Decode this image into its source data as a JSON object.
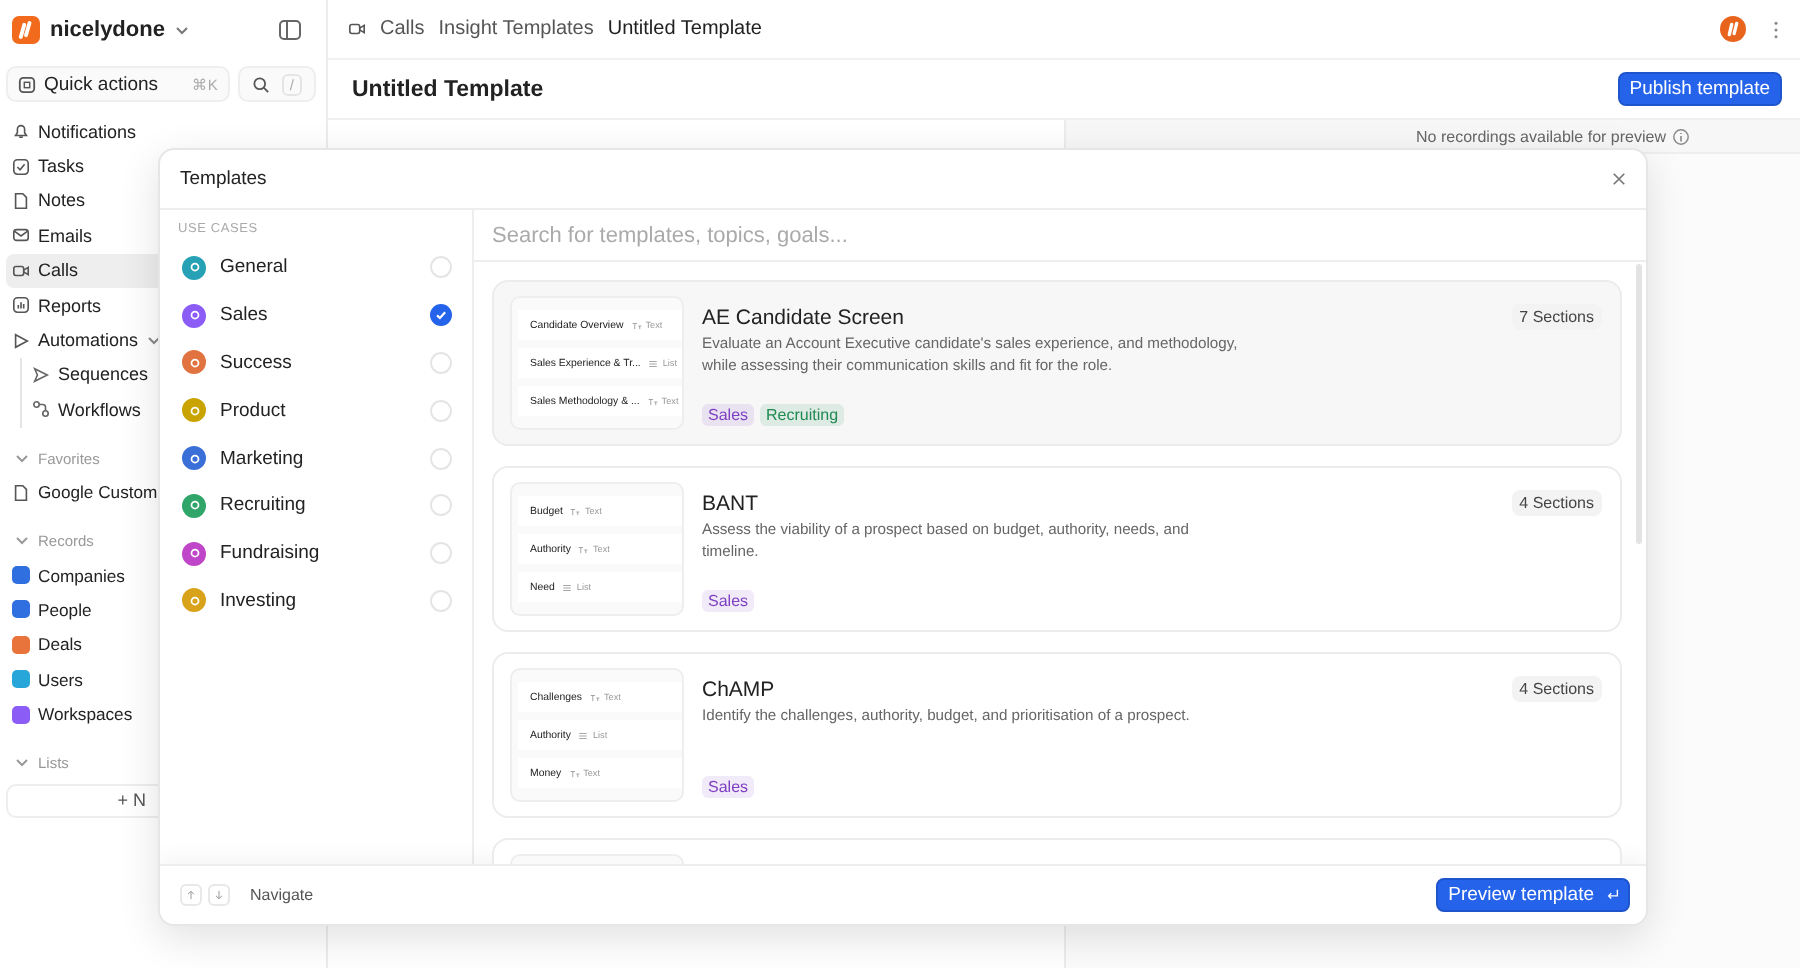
{
  "app": {
    "workspace": "nicelydone"
  },
  "sidebar": {
    "quick_actions": {
      "label": "Quick actions",
      "shortcut": "⌘K",
      "search_shortcut": "/"
    },
    "nav": [
      {
        "label": "Notifications",
        "selected": false
      },
      {
        "label": "Tasks",
        "selected": false
      },
      {
        "label": "Notes",
        "selected": false
      },
      {
        "label": "Emails",
        "selected": false
      },
      {
        "label": "Calls",
        "selected": true
      },
      {
        "label": "Reports",
        "selected": false
      },
      {
        "label": "Automations",
        "selected": false,
        "expanded": true,
        "children": [
          {
            "label": "Sequences",
            "selected": false
          },
          {
            "label": "Workflows",
            "selected": false
          }
        ]
      }
    ],
    "favorites": {
      "heading": "Favorites",
      "expanded": true,
      "items": [
        {
          "label": "Google Custom"
        }
      ]
    },
    "records": {
      "heading": "Records",
      "expanded": true,
      "items": [
        {
          "label": "Companies",
          "color": "#2f6fe0"
        },
        {
          "label": "People",
          "color": "#2f6fe0"
        },
        {
          "label": "Deals",
          "color": "#e8743b"
        },
        {
          "label": "Users",
          "color": "#27a6d9"
        },
        {
          "label": "Workspaces",
          "color": "#8b5cf6"
        }
      ]
    },
    "lists": {
      "heading": "Lists",
      "expanded": true,
      "button": "+ N"
    }
  },
  "main": {
    "breadcrumbs": [
      "Calls",
      "Insight Templates",
      "Untitled Template"
    ],
    "title": "Untitled Template",
    "publish_button": "Publish template",
    "preview_notice": "No recordings available for preview"
  },
  "modal": {
    "title": "Templates",
    "category_heading": "USE CASES",
    "categories": [
      {
        "label": "General",
        "color": "#26a1b5",
        "checked": false
      },
      {
        "label": "Sales",
        "color": "#8b5cf6",
        "checked": true
      },
      {
        "label": "Success",
        "color": "#e0733f",
        "checked": false
      },
      {
        "label": "Product",
        "color": "#c9a400",
        "checked": false
      },
      {
        "label": "Marketing",
        "color": "#3b6fd8",
        "checked": false
      },
      {
        "label": "Recruiting",
        "color": "#2fa56a",
        "checked": false
      },
      {
        "label": "Fundraising",
        "color": "#c046c9",
        "checked": false
      },
      {
        "label": "Investing",
        "color": "#d9a21b",
        "checked": false
      }
    ],
    "search": {
      "placeholder": "Search for templates, topics, goals..."
    },
    "templates": [
      {
        "title": "AE Candidate Screen",
        "description": "Evaluate an Account Executive candidate's sales experience, and methodology, while assessing their communication skills and fit for the role.",
        "sections": "7 Sections",
        "tags": [
          {
            "label": "Sales",
            "color": "#7e3fc2"
          },
          {
            "label": "Recruiting",
            "color": "#1f8a52"
          }
        ],
        "preview": [
          {
            "label": "Candidate Overview",
            "kind": "text",
            "type": "Text"
          },
          {
            "label": "Sales Experience & Tr...",
            "kind": "list",
            "type": "List"
          },
          {
            "label": "Sales Methodology & ...",
            "kind": "text",
            "type": "Text"
          }
        ]
      },
      {
        "title": "BANT",
        "description": "Assess the viability of a prospect based on budget, authority, needs, and timeline.",
        "sections": "4 Sections",
        "tags": [
          {
            "label": "Sales",
            "color": "#7e3fc2"
          }
        ],
        "preview": [
          {
            "label": "Budget",
            "kind": "text",
            "type": "Text"
          },
          {
            "label": "Authority",
            "kind": "text",
            "type": "Text"
          },
          {
            "label": "Need",
            "kind": "list",
            "type": "List"
          }
        ]
      },
      {
        "title": "ChAMP",
        "description": "Identify the challenges, authority, budget, and prioritisation of a prospect.",
        "sections": "4 Sections",
        "tags": [
          {
            "label": "Sales",
            "color": "#7e3fc2"
          }
        ],
        "preview": [
          {
            "label": "Challenges",
            "kind": "text",
            "type": "Text"
          },
          {
            "label": "Authority",
            "kind": "list",
            "type": "List"
          },
          {
            "label": "Money",
            "kind": "text",
            "type": "Text"
          }
        ]
      }
    ],
    "footer": {
      "navigate": "Navigate",
      "preview_button": "Preview template"
    }
  }
}
